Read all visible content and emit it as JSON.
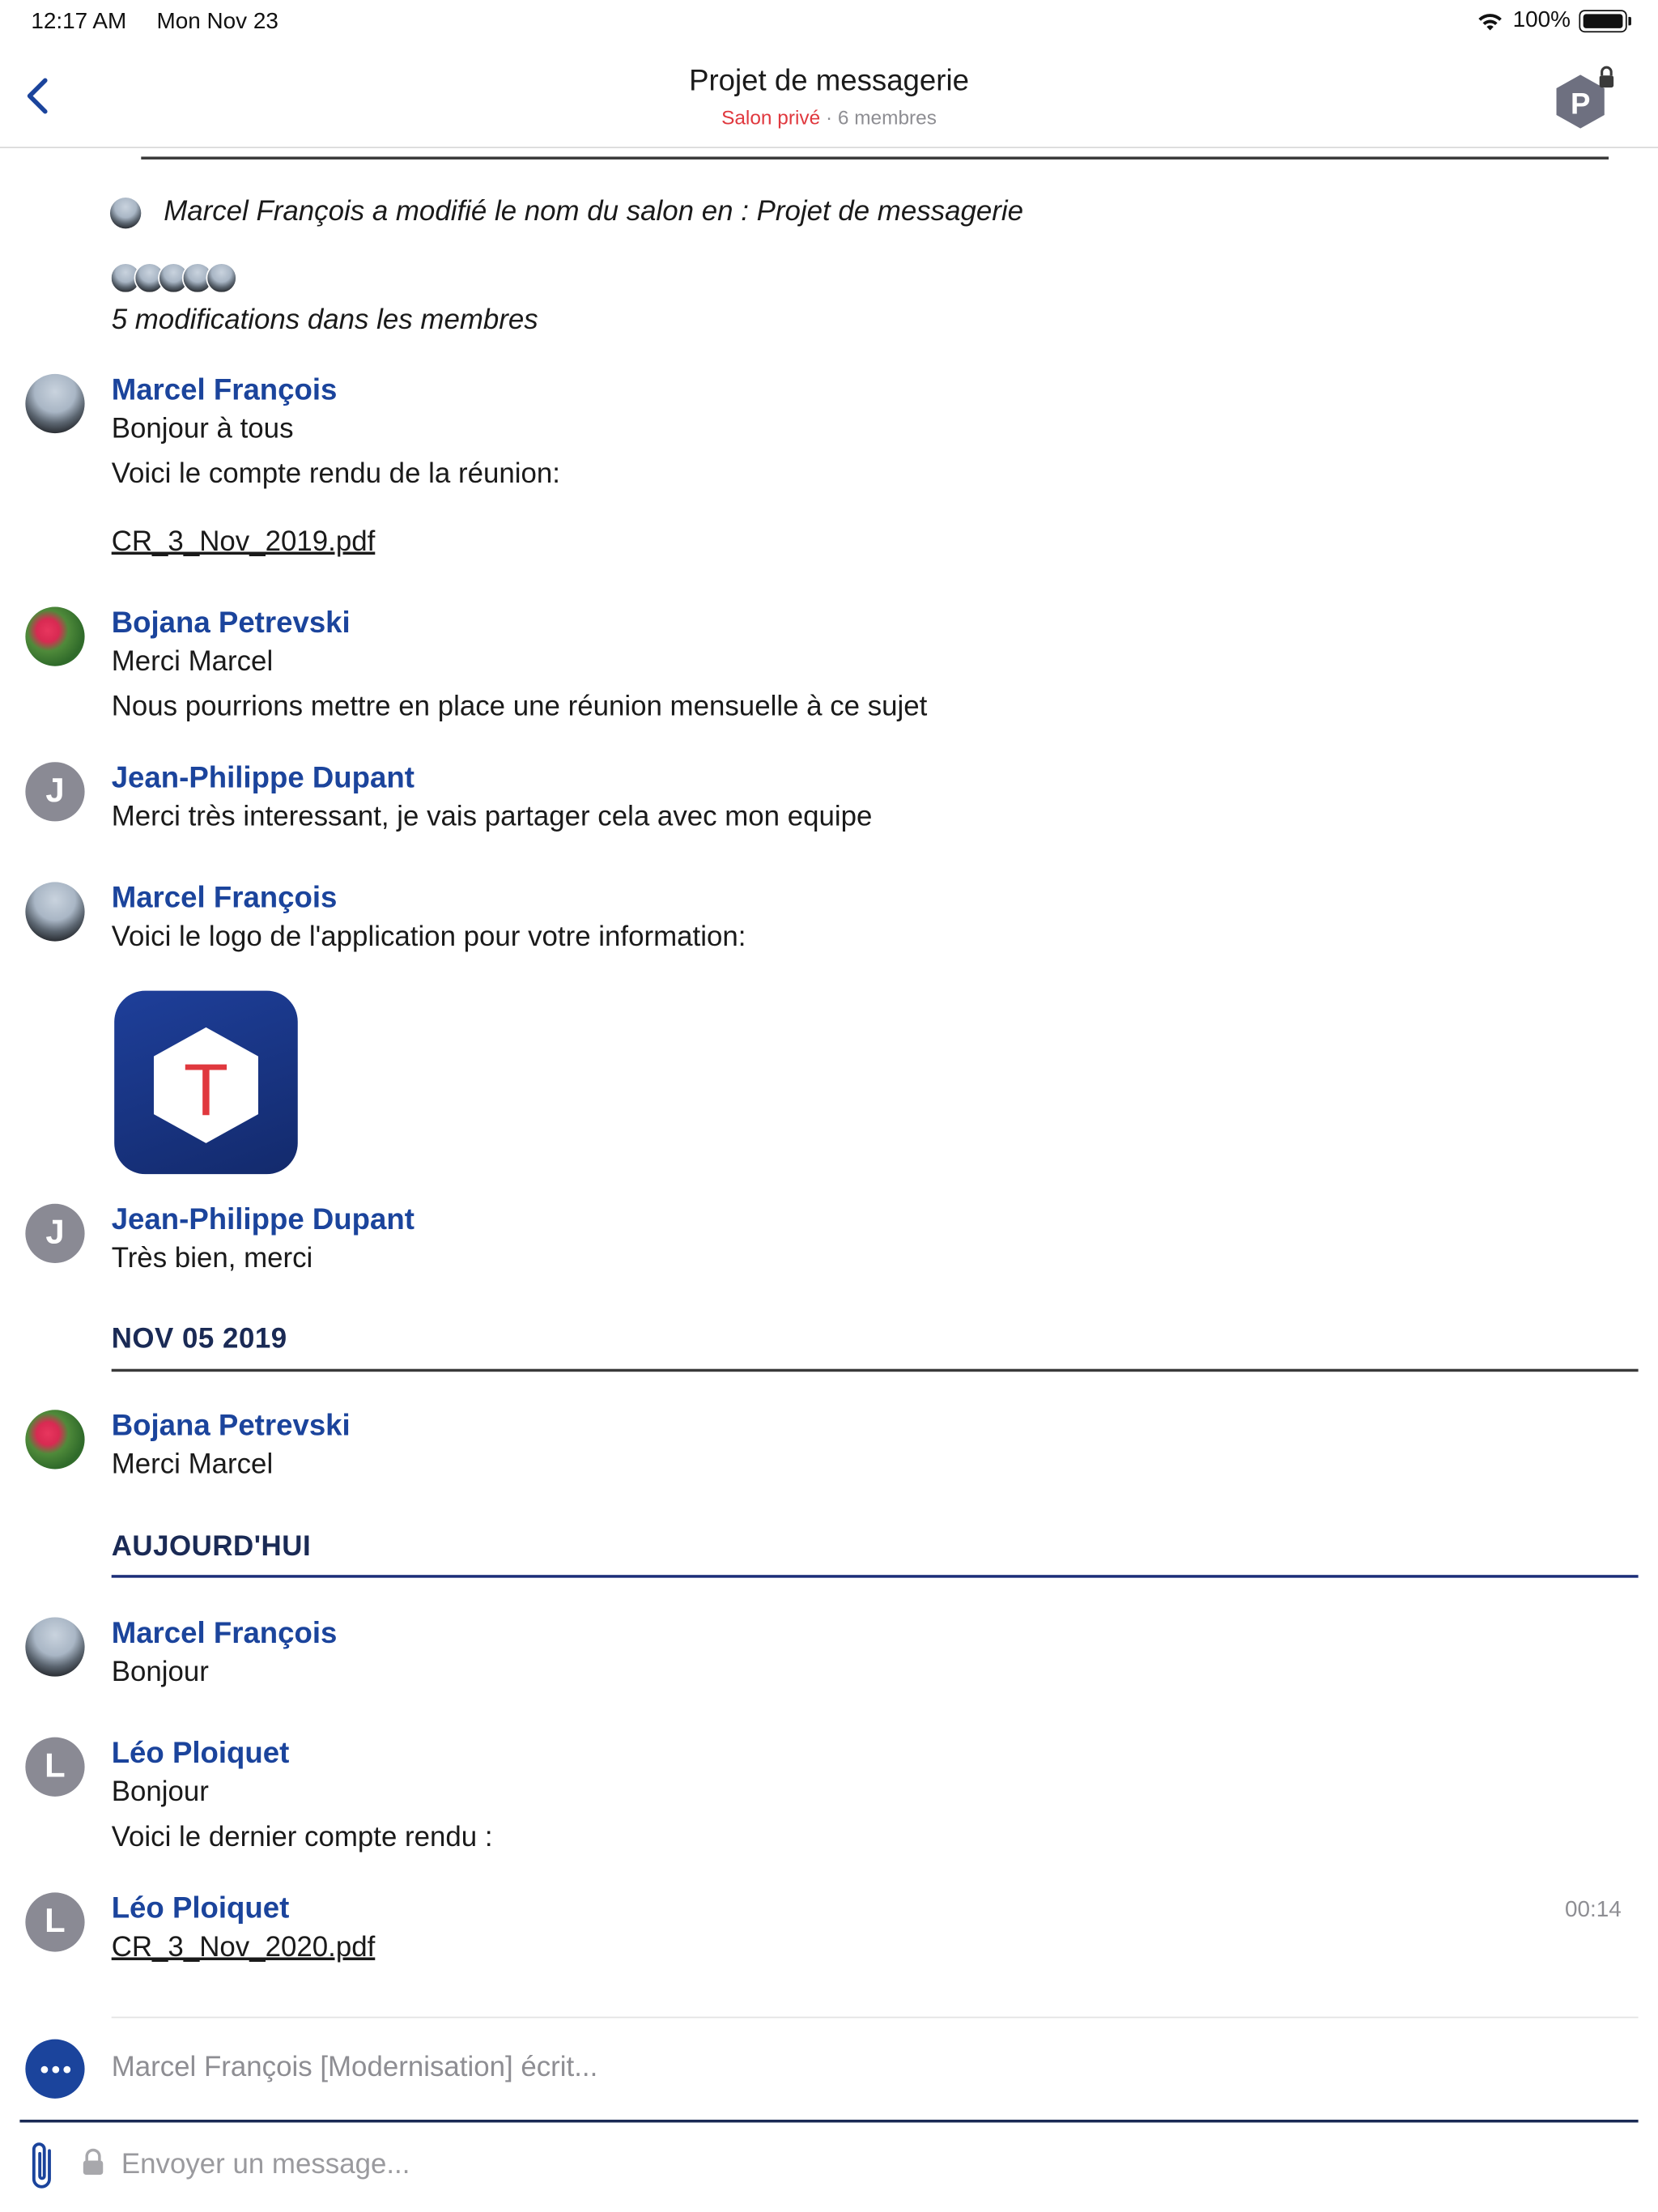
{
  "status_bar": {
    "time": "12:17 AM",
    "date": "Mon Nov 23",
    "battery": "100%",
    "battery_level": 1.0
  },
  "header": {
    "title": "Projet de messagerie",
    "privacy": "Salon privé",
    "separator": "·",
    "members": "6 membres",
    "room_avatar_letter": "P"
  },
  "system": {
    "rename_event": "Marcel François a modifié le nom du salon en : Projet de messagerie",
    "member_changes": "5 modifications dans les membres"
  },
  "messages": [
    {
      "author": "Marcel François",
      "lines": [
        "Bonjour à tous",
        "Voici le compte rendu de la réunion:"
      ],
      "attachment": "CR_3_Nov_2019.pdf"
    },
    {
      "author": "Bojana Petrevski",
      "lines": [
        "Merci Marcel",
        "Nous pourrions mettre en place une réunion mensuelle à ce sujet"
      ]
    },
    {
      "author": "Jean-Philippe Dupant",
      "avatar_letter": "J",
      "lines": [
        "Merci très interessant, je vais partager cela avec mon equipe"
      ]
    },
    {
      "author": "Marcel François",
      "lines": [
        "Voici le logo de l'application pour votre information:"
      ],
      "image": "app-logo",
      "image_letter": "T"
    },
    {
      "author": "Jean-Philippe Dupant",
      "avatar_letter": "J",
      "lines": [
        "Très bien, merci"
      ]
    },
    {
      "author": "Bojana Petrevski",
      "lines": [
        "Merci Marcel"
      ]
    },
    {
      "author": "Marcel François",
      "lines": [
        "Bonjour"
      ]
    },
    {
      "author": "Léo Ploiquet",
      "avatar_letter": "L",
      "lines": [
        "Bonjour",
        "Voici le dernier compte rendu :"
      ]
    },
    {
      "author": "Léo Ploiquet",
      "avatar_letter": "L",
      "attachment": "CR_3_Nov_2020.pdf",
      "time": "00:14"
    }
  ],
  "date_separators": [
    "NOV 05 2019",
    "AUJOURD'HUI"
  ],
  "typing": {
    "text": "Marcel François [Modernisation] écrit..."
  },
  "composer": {
    "placeholder": "Envoyer un message..."
  },
  "colors": {
    "accent": "#1b449c",
    "private_label": "#e0383e",
    "date_separator_text": "#1a2a55",
    "today_rule": "#1b2d78",
    "muted_text": "#8e8e93",
    "logo_background": "#1e3f9a",
    "logo_letter": "#e0383e"
  },
  "icons": {
    "back": "chevron-left-icon",
    "room_lock": "lock-icon",
    "wifi": "wifi-icon",
    "battery": "battery-icon",
    "typing": "ellipsis-icon",
    "attach": "paperclip-icon",
    "composer_lock": "lock-icon"
  }
}
